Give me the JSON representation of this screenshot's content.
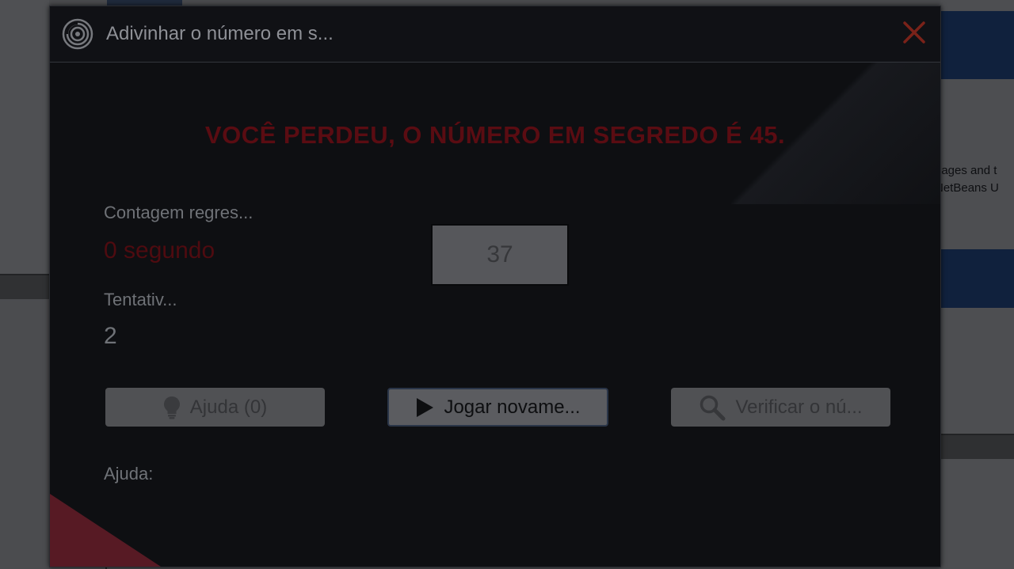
{
  "window": {
    "title": "Adivinhar o número em s..."
  },
  "game": {
    "result_message": "VOCÊ PERDEU, O NÚMERO EM SEGREDO É 45.",
    "countdown_label": "Contagem regres...",
    "countdown_value": "0 segundo",
    "attempts_label": "Tentativ...",
    "attempts_value": "2",
    "number_input_value": "37",
    "help_label": "Ajuda:"
  },
  "buttons": {
    "help_label": "Ajuda (0)",
    "play_again_label": "Jogar novame...",
    "verify_label": "Verificar o nú..."
  },
  "background": {
    "right_text_line1": "uages and t",
    "right_text_line2": "NetBeans U"
  },
  "icons": {
    "app": "app-logo-icon",
    "close": "close-icon",
    "help": "lightbulb-icon",
    "play": "play-icon",
    "verify": "search-icon"
  },
  "colors": {
    "accent_red": "#c0392b",
    "dialog_bg": "#0e0f12",
    "lost_message": "#5a0c12"
  }
}
